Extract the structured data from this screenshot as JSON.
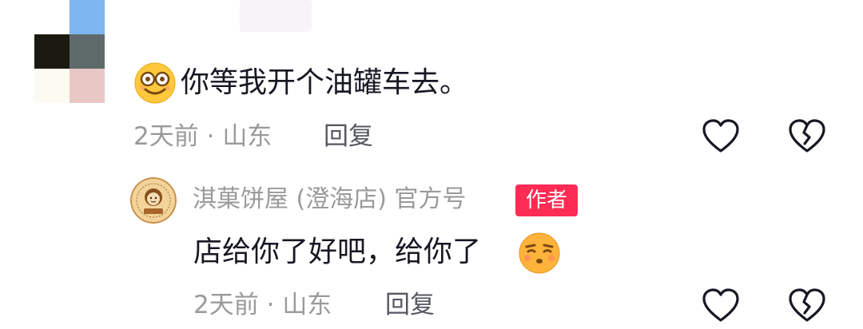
{
  "comment1": {
    "text": "你等我开个油罐车去。",
    "time": "2天前",
    "separator": "·",
    "location": "山东",
    "reply_label": "回复",
    "leading_emoji": "smiling-glasses-emoji"
  },
  "reply1": {
    "author": "淇菓饼屋 (澄海店) 官方号",
    "badge": "作者",
    "text": "店给你了好吧，给你了",
    "time": "2天前",
    "separator": "·",
    "location": "山东",
    "reply_label": "回复",
    "trailing_emoji": "smug-face-emoji"
  },
  "icons": {
    "like": "heart-outline-icon",
    "dislike": "broken-heart-icon"
  },
  "colors": {
    "text_primary": "#161823",
    "text_secondary": "#9a9a9a",
    "badge_bg": "#fe2c55",
    "emoji_yellow": "#ffc83d"
  }
}
